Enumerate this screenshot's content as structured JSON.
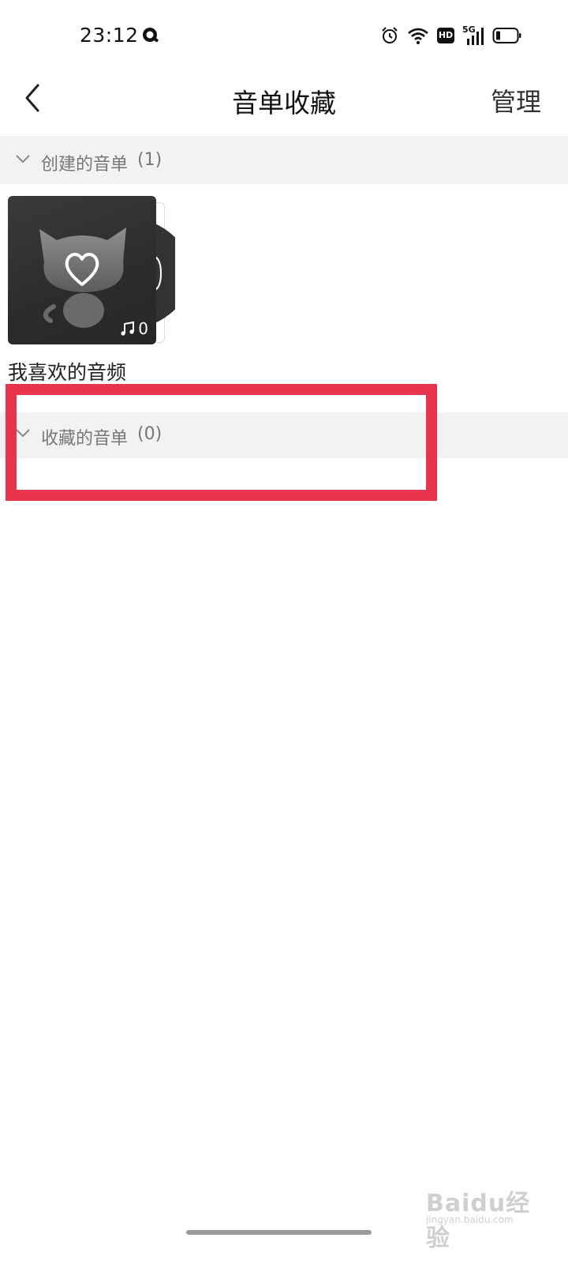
{
  "status_bar": {
    "time": "23:12",
    "icons": [
      "q-app-icon",
      "alarm-icon",
      "wifi-icon",
      "hd-icon",
      "signal-5g-icon",
      "battery-icon"
    ],
    "hd_label": "HD",
    "network_label": "5G"
  },
  "nav": {
    "title": "音单收藏",
    "manage_label": "管理",
    "back_icon": "chevron-left-icon"
  },
  "sections": [
    {
      "label": "创建的音单",
      "count": "(1)",
      "items": [
        {
          "name": "我喜欢的音频",
          "track_count": "0",
          "cover_icon": "cat-heart-icon"
        }
      ]
    },
    {
      "label": "收藏的音单",
      "count": "(0)",
      "items": []
    }
  ],
  "watermark": {
    "logo": "Baidu经验",
    "url": "jingyan.baidu.com"
  },
  "colors": {
    "highlight": "#e8354d",
    "section_bg": "#f2f2f2",
    "section_text": "#777777",
    "cover_bg": "#2c2c2c"
  }
}
